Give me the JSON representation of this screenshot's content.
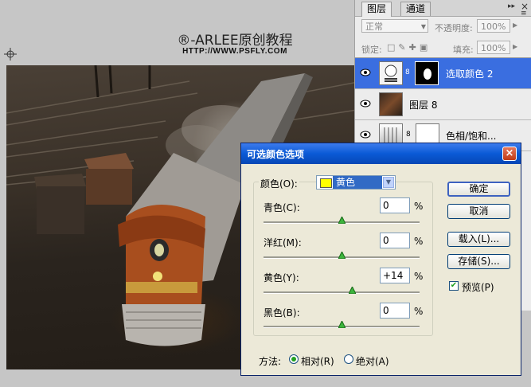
{
  "watermark": {
    "line1": "®-ARLEE原创教程",
    "line2": "HTTP://WWW.PSFLY.COM"
  },
  "layers_panel": {
    "tabs": [
      "图层",
      "通道"
    ],
    "blend_mode": "正常",
    "opacity_label": "不透明度:",
    "opacity_value": "100%",
    "lock_label": "锁定:",
    "fill_label": "填充:",
    "fill_value": "100%",
    "layers": [
      {
        "name": "选取颜色 2",
        "selected": true
      },
      {
        "name": "图层 8",
        "selected": false
      },
      {
        "name": "色相/饱和...",
        "selected": false
      }
    ]
  },
  "dialog": {
    "title": "可选颜色选项",
    "close": "×",
    "colors_label": "颜色(O):",
    "colors_value": "黄色",
    "sliders": [
      {
        "label": "青色(C):",
        "value": "0",
        "unit": "%",
        "level": 0
      },
      {
        "label": "洋红(M):",
        "value": "0",
        "unit": "%",
        "level": 0
      },
      {
        "label": "黄色(Y):",
        "value": "+14",
        "unit": "%",
        "level": 14
      },
      {
        "label": "黑色(B):",
        "value": "0",
        "unit": "%",
        "level": 0
      }
    ],
    "buttons": {
      "ok": "确定",
      "cancel": "取消",
      "load": "载入(L)...",
      "save": "存储(S)..."
    },
    "preview_label": "预览(P)",
    "preview_checked": true,
    "method_label": "方法:",
    "method_relative": "相对(R)",
    "method_absolute": "绝对(A)",
    "method_selected": "relative"
  },
  "colors": {
    "title_bar": "#0a5ad6",
    "selection": "#316ac5",
    "swatch_yellow": "#ffff00",
    "layer_selected": "#3a6ee0"
  }
}
